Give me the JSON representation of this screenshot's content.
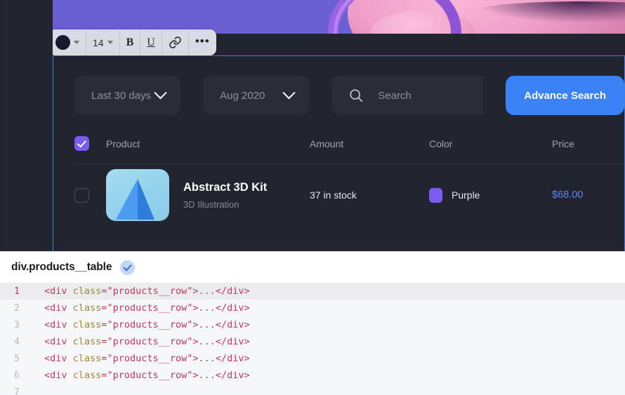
{
  "format_toolbar": {
    "color_swatch_value": "#171a2b",
    "font_size": "14",
    "bold_label": "B",
    "underline_label": "U",
    "link_icon": "link-icon",
    "more_label": "•••"
  },
  "filters": {
    "date_range": {
      "label": "Last 30 days",
      "icon": "chevron-down-icon"
    },
    "month": {
      "label": "Aug 2020",
      "icon": "chevron-down-icon"
    },
    "search": {
      "placeholder": "Search",
      "value": "",
      "icon": "search-icon"
    },
    "advance_button": "Advance Search"
  },
  "table": {
    "select_all_checked": true,
    "columns": [
      {
        "key": "product",
        "label": "Product"
      },
      {
        "key": "amount",
        "label": "Amount"
      },
      {
        "key": "color",
        "label": "Color"
      },
      {
        "key": "price",
        "label": "Price"
      }
    ],
    "rows": [
      {
        "selected": false,
        "thumbnail": "blue-pyramid-3d-icon",
        "title": "Abstract 3D Kit",
        "subtitle": "3D Illustration",
        "amount": "37 in stock",
        "color_name": "Purple",
        "color_hex": "#7a5cf0",
        "price": "$68.00"
      }
    ]
  },
  "devtools": {
    "selected_element": "div.products__table",
    "badge_icon": "check-circle-icon",
    "code_lines": [
      {
        "n": "1",
        "active": true,
        "tag_open": "<div",
        "attr": "class",
        "eq": "=",
        "value": "\"products__row\"",
        "gt": ">",
        "dots": "...",
        "tag_close": "</div>"
      },
      {
        "n": "2",
        "active": false,
        "tag_open": "<div",
        "attr": "class",
        "eq": "=",
        "value": "\"products__row\"",
        "gt": ">",
        "dots": "...",
        "tag_close": "</div>"
      },
      {
        "n": "3",
        "active": false,
        "tag_open": "<div",
        "attr": "class",
        "eq": "=",
        "value": "\"products__row\"",
        "gt": ">",
        "dots": "...",
        "tag_close": "</div>"
      },
      {
        "n": "4",
        "active": false,
        "tag_open": "<div",
        "attr": "class",
        "eq": "=",
        "value": "\"products__row\"",
        "gt": ">",
        "dots": "...",
        "tag_close": "</div>"
      },
      {
        "n": "5",
        "active": false,
        "tag_open": "<div",
        "attr": "class",
        "eq": "=",
        "value": "\"products__row\"",
        "gt": ">",
        "dots": "...",
        "tag_close": "</div>"
      },
      {
        "n": "6",
        "active": false,
        "tag_open": "<div",
        "attr": "class",
        "eq": "=",
        "value": "\"products__row\"",
        "gt": ">",
        "dots": "...",
        "tag_close": "</div>"
      },
      {
        "n": "7",
        "active": false,
        "tag_open": "",
        "attr": "",
        "eq": "",
        "value": "",
        "gt": "",
        "dots": "",
        "tag_close": ""
      }
    ]
  },
  "theme": {
    "panel_bg": "#22252f",
    "control_bg": "#2a2d38",
    "accent_blue": "#3b82f6",
    "accent_purple": "#7a5cf0",
    "price_blue": "#5b84f5",
    "selection_outline": "#3f7de0"
  }
}
